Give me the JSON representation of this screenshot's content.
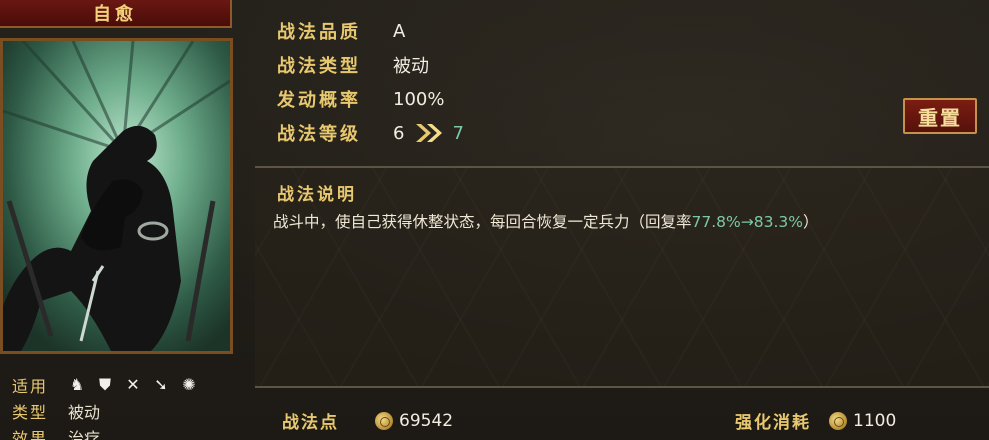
{
  "skill": {
    "name": "自愈"
  },
  "stats": [
    {
      "label": "战法品质",
      "value": "A"
    },
    {
      "label": "战法类型",
      "value": "被动"
    },
    {
      "label": "发动概率",
      "value": "100%"
    }
  ],
  "level": {
    "label": "战法等级",
    "current": "6",
    "next": "7"
  },
  "reset_button": "重置",
  "description": {
    "title": "战法说明",
    "text": "战斗中，使自己获得休整状态，每回合恢复一定兵力（回复率",
    "highlight": "77.8%→83.3%",
    "suffix": "）"
  },
  "info": {
    "applicable_label": "适用",
    "applicable_icons": [
      "cavalry-icon",
      "shield-icon",
      "bow-icon",
      "spear-icon",
      "chariot-icon"
    ],
    "type_label": "类型",
    "type_value": "被动",
    "effect_label": "效果",
    "effect_value": "治疗"
  },
  "footer": {
    "points_label": "战法点",
    "points_value": "69542",
    "cost_label": "强化消耗",
    "cost_value": "1100"
  },
  "colors": {
    "gold_label": "#e8c86e",
    "highlight_green": "#7cc8a8",
    "banner_red": "#6a1712"
  }
}
